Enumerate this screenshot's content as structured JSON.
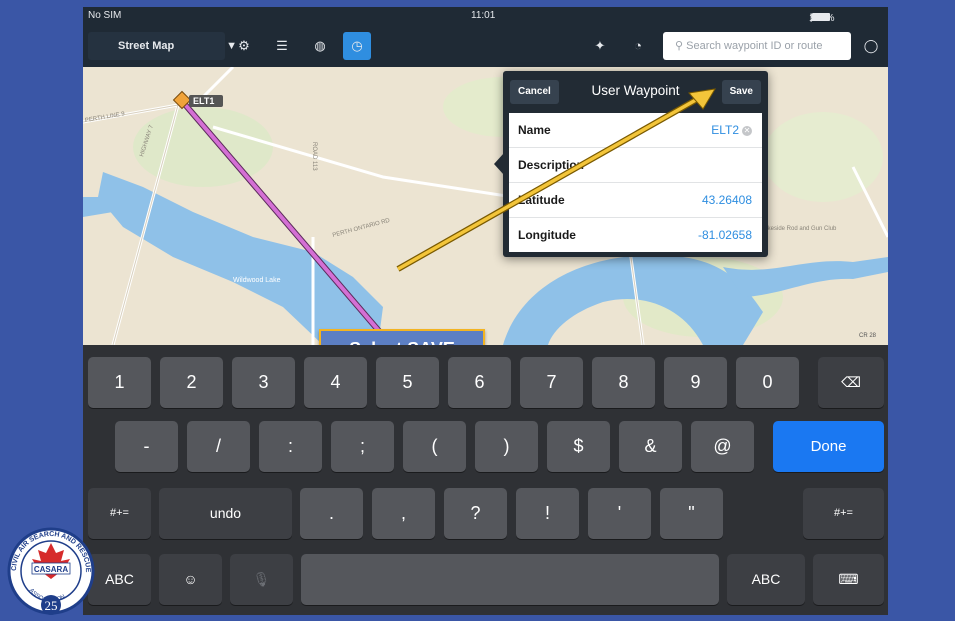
{
  "status": {
    "carrier": "No SIM",
    "time": "11:01",
    "battery": "100%"
  },
  "toolbar": {
    "map_type": "Street Map",
    "search_placeholder": "Search waypoint ID or route"
  },
  "map": {
    "waypoint_label": "ELT1",
    "roads": [
      "PERTH LINE 9",
      "HIGHWAY 7",
      "ROAD 113",
      "PERTH ONTARIO RD",
      "LINE 5",
      "ROAD 120",
      "CR 28"
    ],
    "water_label": "Wildwood Lake",
    "place_label": "Lakeside Rod and Gun Club"
  },
  "popup": {
    "cancel_label": "Cancel",
    "title": "User Waypoint",
    "save_label": "Save",
    "rows": [
      {
        "key": "Name",
        "value": "ELT2"
      },
      {
        "key": "Description",
        "value": ""
      },
      {
        "key": "Latitude",
        "value": "43.26408"
      },
      {
        "key": "Longitude",
        "value": "-81.02658"
      }
    ]
  },
  "callout": "Select SAVE",
  "keyboard": {
    "row1": [
      "1",
      "2",
      "3",
      "4",
      "5",
      "6",
      "7",
      "8",
      "9",
      "0"
    ],
    "row2": [
      "-",
      "/",
      ":",
      ";",
      "(",
      ")",
      "$",
      "&",
      "@"
    ],
    "done": "Done",
    "row3_left": "#+=",
    "undo": "undo",
    "row3": [
      ".",
      ",",
      "?",
      "!",
      "'",
      "\""
    ],
    "row3_right": "#+=",
    "abc_left": "ABC",
    "abc_right": "ABC"
  },
  "logo": {
    "text_top": "CIVIL AIR SEARCH AND RESCUE",
    "center": "CASARA",
    "bottom": "ASSOCIATION",
    "years": "25"
  },
  "colors": {
    "accent": "#1a78f2",
    "callout_bg": "#5c7fc4",
    "callout_border": "#f3b422",
    "route": "#d46fd4",
    "water": "#8fc1e8"
  }
}
